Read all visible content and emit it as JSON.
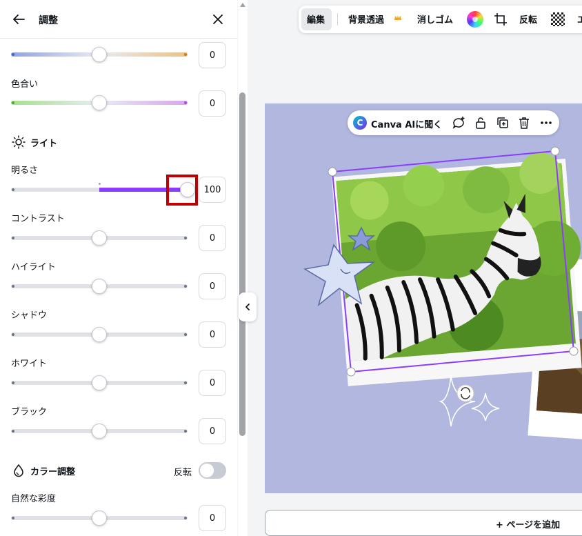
{
  "panel": {
    "title": "調整",
    "temperature": {
      "value": "0",
      "level": 0.5
    },
    "tint": {
      "label": "色合い",
      "value": "0",
      "level": 0.5
    },
    "light_section": {
      "title": "ライト"
    },
    "brightness": {
      "label": "明るさ",
      "value": "100",
      "level": 1.0
    },
    "contrast": {
      "label": "コントラスト",
      "value": "0",
      "level": 0.5
    },
    "highlights": {
      "label": "ハイライト",
      "value": "0",
      "level": 0.5
    },
    "shadows": {
      "label": "シャドウ",
      "value": "0",
      "level": 0.5
    },
    "whites": {
      "label": "ホワイト",
      "value": "0",
      "level": 0.5
    },
    "blacks": {
      "label": "ブラック",
      "value": "0",
      "level": 0.5
    },
    "color_section": {
      "title": "カラー調整",
      "invert_label": "反転",
      "invert_on": false
    },
    "vibrance": {
      "label": "自然な彩度",
      "value": "0",
      "level": 0.5
    }
  },
  "toolbar": {
    "edit": "編集",
    "bg_remove": "背景透過",
    "eraser": "消しゴム",
    "flip": "反転",
    "overflow": "エ"
  },
  "context_menu": {
    "ai_logo": "C",
    "ai_label": "Canva AIに聞く"
  },
  "footer": {
    "add_page": "+ ページを追加"
  },
  "colors": {
    "accent": "#8b3dff",
    "canvas_bg": "#b1b7de",
    "highlight_box": "#c00000"
  }
}
